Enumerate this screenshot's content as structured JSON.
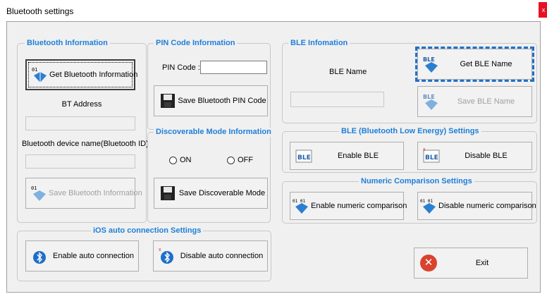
{
  "window": {
    "title": "Bluetooth settings",
    "close_label": "x"
  },
  "bt_info": {
    "title": "Bluetooth Information",
    "get_button": "Get Bluetooth Information",
    "address_label": "BT Address",
    "address_value": "",
    "device_name_label": "Bluetooth device name(Bluetooth ID)",
    "device_name_value": "",
    "save_button": "Save Bluetooth Information"
  },
  "pin": {
    "title": "PIN Code Information",
    "label": "PIN Code :",
    "value": "",
    "save_button": "Save Bluetooth PIN Code"
  },
  "discoverable": {
    "title": "Discoverable Mode Information",
    "on_label": "ON",
    "off_label": "OFF",
    "save_button": "Save Discoverable Mode"
  },
  "ble_info": {
    "title": "BLE Infomation",
    "name_label": "BLE Name",
    "name_value": "",
    "get_button": "Get BLE Name",
    "save_button": "Save BLE Name"
  },
  "ble_settings": {
    "title": "BLE (Bluetooth Low Energy) Settings",
    "enable_button": "Enable BLE",
    "disable_button": "Disable BLE"
  },
  "numeric": {
    "title": "Numeric Comparison Settings",
    "enable_button": "Enable numeric comparison",
    "disable_button": "Disable numeric comparison"
  },
  "ios": {
    "title": "iOS auto connection Settings",
    "enable_button": "Enable auto connection",
    "disable_button": "Disable auto connection"
  },
  "exit": {
    "label": "Exit"
  },
  "colors": {
    "group_title": "#1e7fd8",
    "focus_dash": "#1e70c8",
    "exit_icon": "#d9432e"
  },
  "icons": {
    "bt_get": "bluetooth-binary-icon",
    "bt_save": "bluetooth-binary-icon",
    "pin_save": "floppy-disk-icon",
    "disc_save": "floppy-disk-icon",
    "ble_get": "bluetooth-ble-icon",
    "ble_save": "bluetooth-ble-icon",
    "ble_enable": "ble-badge-icon",
    "ble_disable": "ble-badge-icon",
    "numeric_enable": "bluetooth-binary-icon",
    "numeric_disable": "bluetooth-binary-icon",
    "ios_enable": "bluetooth-circle-icon",
    "ios_disable": "bluetooth-circle-icon",
    "exit": "error-x-icon"
  }
}
